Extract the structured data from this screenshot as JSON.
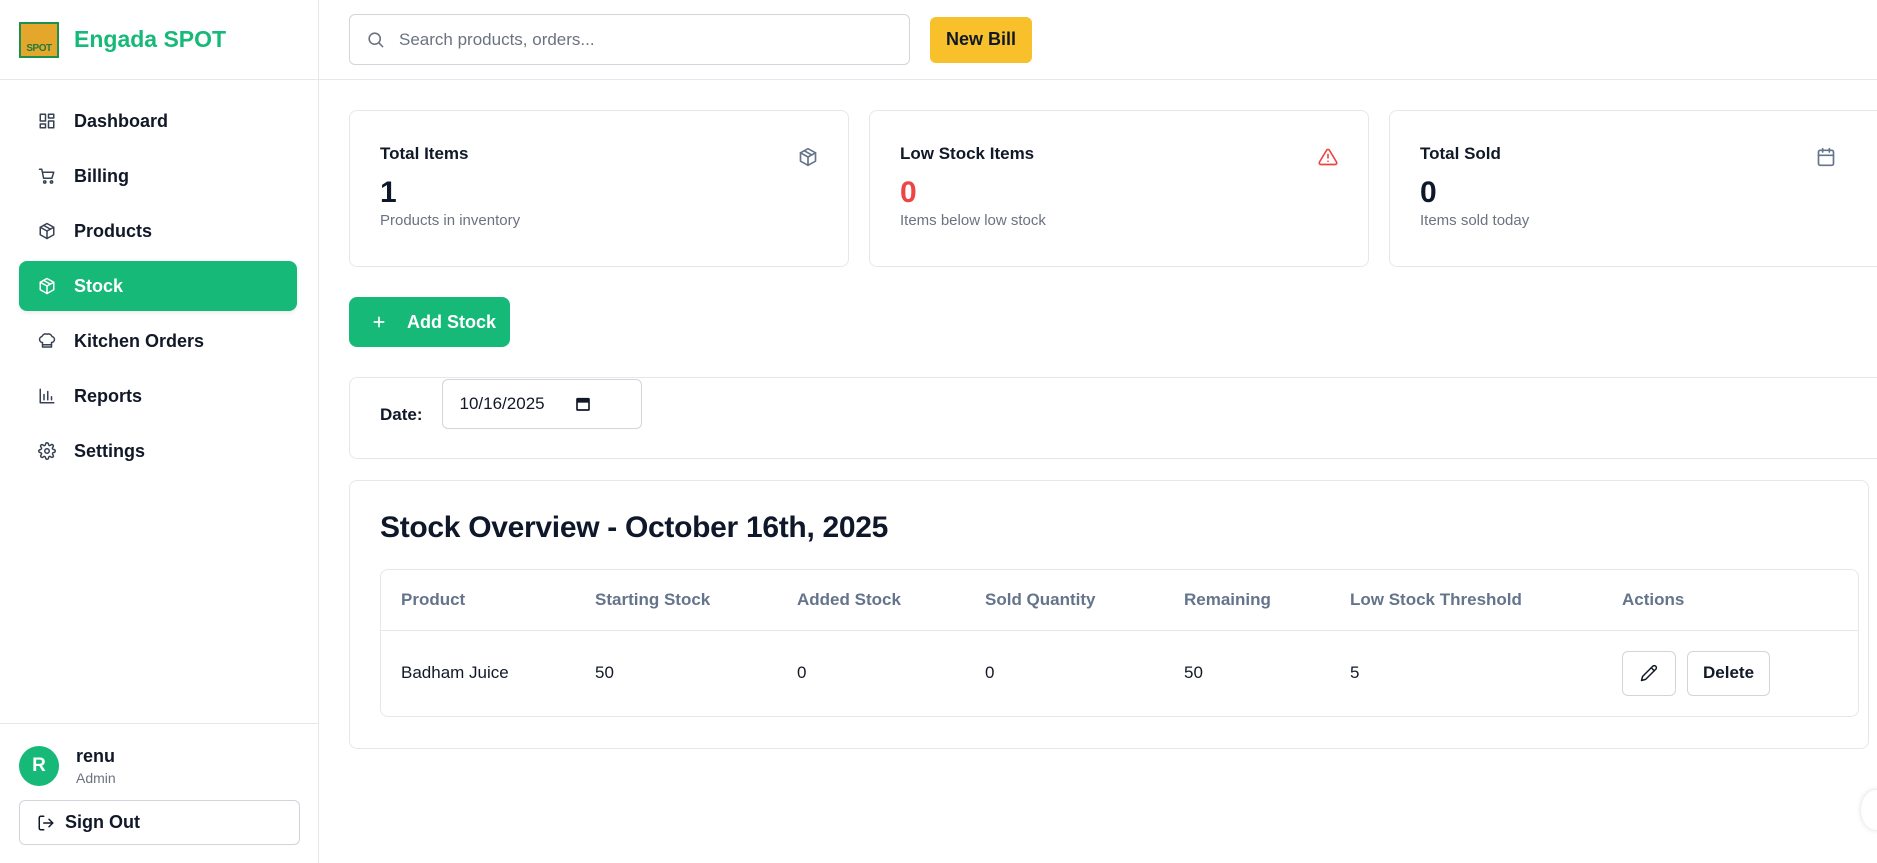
{
  "brand": {
    "name": "Engada SPOT",
    "logo_text": "SPOT"
  },
  "sidebar": {
    "items": [
      {
        "label": "Dashboard",
        "icon": "dashboard-icon"
      },
      {
        "label": "Billing",
        "icon": "cart-icon"
      },
      {
        "label": "Products",
        "icon": "package-icon"
      },
      {
        "label": "Stock",
        "icon": "package-icon",
        "active": true
      },
      {
        "label": "Kitchen Orders",
        "icon": "chef-hat-icon"
      },
      {
        "label": "Reports",
        "icon": "bar-chart-icon"
      },
      {
        "label": "Settings",
        "icon": "gear-icon"
      }
    ]
  },
  "user": {
    "initial": "R",
    "name": "renu",
    "role": "Admin",
    "signout_label": "Sign Out"
  },
  "topbar": {
    "search_placeholder": "Search products, orders...",
    "new_bill_label": "New Bill"
  },
  "stats": [
    {
      "title": "Total Items",
      "value": "1",
      "sub": "Products in inventory",
      "icon": "package-icon"
    },
    {
      "title": "Low Stock Items",
      "value": "0",
      "sub": "Items below low stock",
      "icon": "alert-triangle-icon",
      "accent": "#ef4444"
    },
    {
      "title": "Total Sold",
      "value": "0",
      "sub": "Items sold today",
      "icon": "calendar-icon"
    }
  ],
  "add_stock_label": "Add Stock",
  "date_filter": {
    "label": "Date:",
    "value": "10/16/2025"
  },
  "overview": {
    "title": "Stock Overview - October 16th, 2025",
    "columns": [
      "Product",
      "Starting Stock",
      "Added Stock",
      "Sold Quantity",
      "Remaining",
      "Low Stock Threshold",
      "Actions"
    ],
    "rows": [
      {
        "product": "Badham Juice",
        "starting": "50",
        "added": "0",
        "sold": "0",
        "remaining": "50",
        "threshold": "5",
        "delete_label": "Delete"
      }
    ]
  },
  "colors": {
    "brand_green": "#16b978",
    "accent_yellow": "#f8c12b",
    "danger": "#ef4444"
  }
}
